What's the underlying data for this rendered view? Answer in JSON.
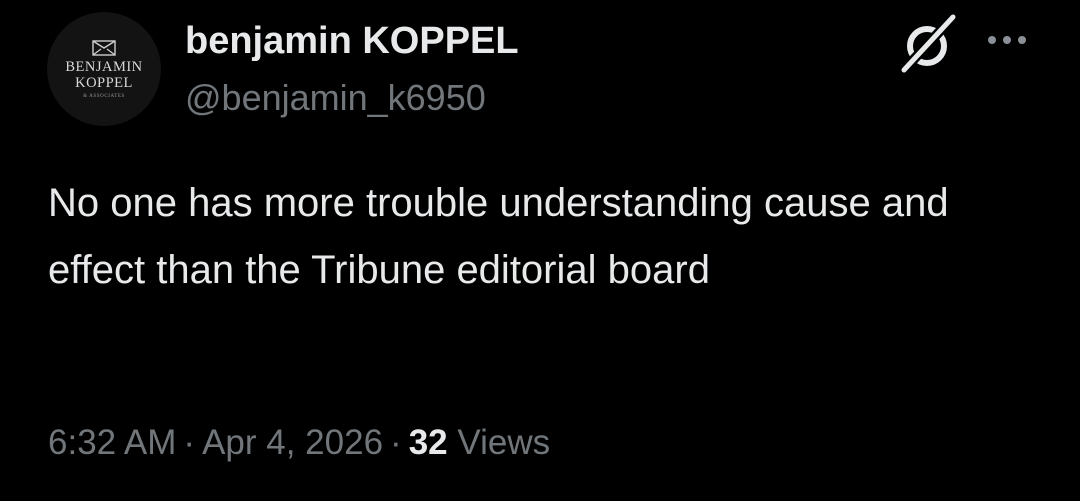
{
  "author": {
    "avatar": {
      "line1": "BENJAMIN",
      "line2": "KOPPEL",
      "line3": "& ASSOCIATES"
    },
    "display_name": "benjamin KOPPEL",
    "handle": "@benjamin_k6950"
  },
  "tweet": {
    "text": "No one has more trouble understanding cause and effect than the Tribune editorial board"
  },
  "meta": {
    "time": "6:32 AM",
    "separator": "·",
    "date": "Apr 4, 2026",
    "views_count": "32",
    "views_label": "Views"
  },
  "icons": {
    "grok": "grok-icon",
    "more": "more-dots-icon"
  },
  "colors": {
    "background": "#000000",
    "primary_text": "#e7e9ea",
    "secondary_text": "#71767b"
  }
}
